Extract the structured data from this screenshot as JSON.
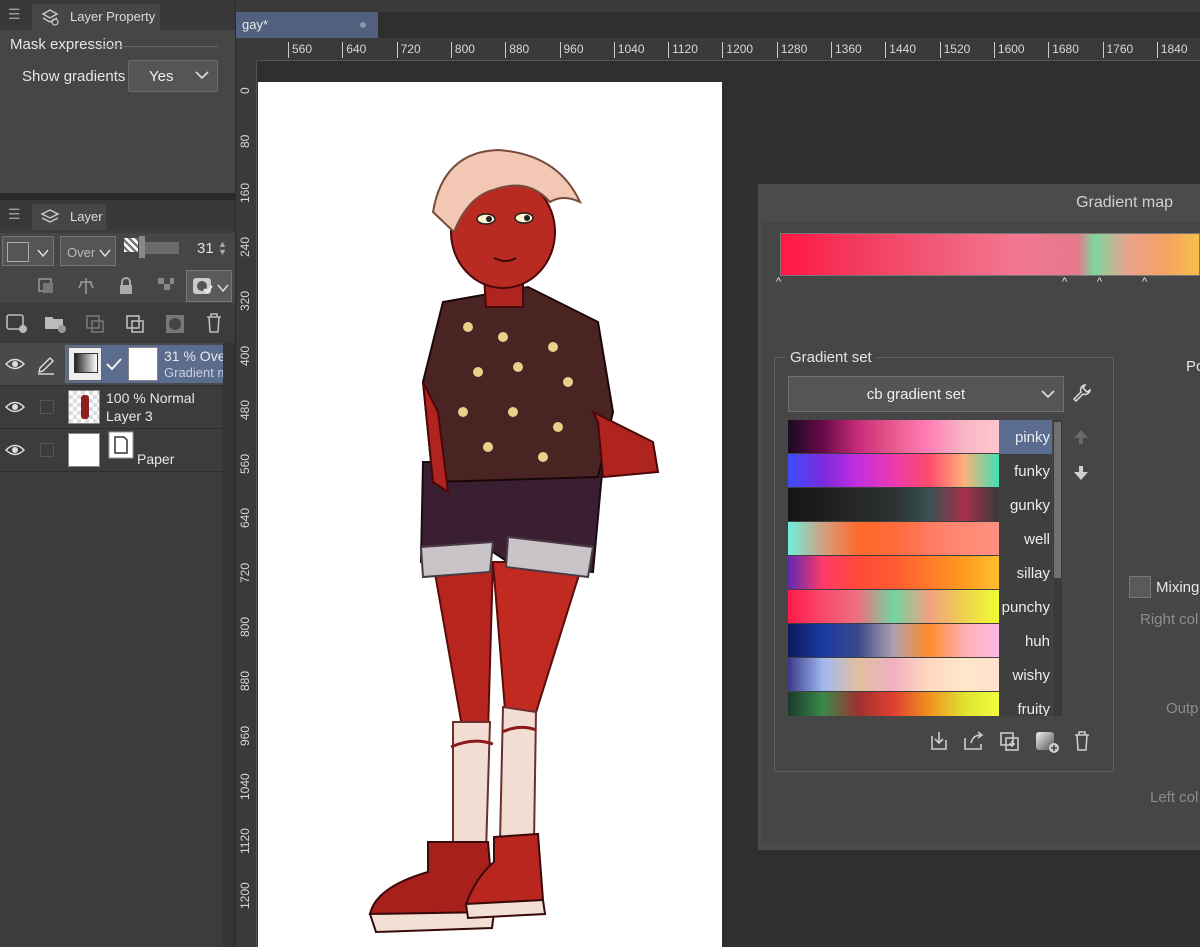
{
  "layer_property": {
    "tab_label": "Layer Property",
    "section_title": "Mask expression",
    "show_gradients_label": "Show gradients",
    "show_gradients_value": "Yes"
  },
  "layer_panel": {
    "tab_label": "Layer",
    "blend_mode": "Over",
    "opacity": "31",
    "layers": [
      {
        "line1": "31 % Ove",
        "line2": "Gradient m",
        "selected": true
      },
      {
        "line1": "100 % Normal",
        "line2": "Layer 3",
        "selected": false
      },
      {
        "line1": "Paper",
        "line2": "",
        "selected": false
      }
    ]
  },
  "document": {
    "tab_title": "gay*"
  },
  "ruler": {
    "horizontal": [
      "560",
      "640",
      "720",
      "800",
      "880",
      "960",
      "1040",
      "1120",
      "1200",
      "1280",
      "1360",
      "1440",
      "1520",
      "1600",
      "1680",
      "1760",
      "1840"
    ],
    "vertical": [
      "0",
      "80",
      "160",
      "240",
      "320",
      "400",
      "480",
      "560",
      "640",
      "720",
      "800",
      "880",
      "960",
      "1040",
      "1120",
      "1200"
    ]
  },
  "gradient_map": {
    "title": "Gradient map",
    "gradient_set_label": "Gradient set",
    "gradient_set_value": "cb gradient set",
    "sets": [
      {
        "name": "pinky",
        "selected": true,
        "colors": [
          "#1a0a1f",
          "#6a0a4a",
          "#c82c7a",
          "#e85a8e",
          "#ff7fb4",
          "#f7b6c4",
          "#ffc6d0"
        ]
      },
      {
        "name": "funky",
        "selected": false,
        "colors": [
          "#3d4cff",
          "#7a2bdc",
          "#c42ee0",
          "#ea3ab0",
          "#ff4a6b",
          "#ffb07a",
          "#40e0b0"
        ]
      },
      {
        "name": "gunky",
        "selected": false,
        "colors": [
          "#141414",
          "#1e1e1e",
          "#272727",
          "#2c3232",
          "#355252",
          "#a8304a",
          "#3a3a3a"
        ]
      },
      {
        "name": "well",
        "selected": false,
        "colors": [
          "#6cf0e0",
          "#d0a080",
          "#ff6a2a",
          "#ff6a3a",
          "#ff7a60",
          "#ff8a74",
          "#ff9080"
        ]
      },
      {
        "name": "sillay",
        "selected": false,
        "colors": [
          "#5e2ab0",
          "#ff3a6a",
          "#ff4a3a",
          "#ff5a30",
          "#ff7a2a",
          "#ff9a20",
          "#ffc030"
        ]
      },
      {
        "name": "punchy",
        "selected": false,
        "colors": [
          "#ff1a4a",
          "#f84a6c",
          "#ee7080",
          "#70d6a0",
          "#f0a080",
          "#f0d050",
          "#f0ff30"
        ]
      },
      {
        "name": "huh",
        "selected": false,
        "colors": [
          "#0a1a5a",
          "#1a3aa0",
          "#3a4a8a",
          "#b0a0b0",
          "#ff8a2a",
          "#ffb0b0",
          "#ffb8e8"
        ]
      },
      {
        "name": "wishy",
        "selected": false,
        "colors": [
          "#3a3a8a",
          "#a0b8f0",
          "#e0c0a0",
          "#f0b0c0",
          "#ffd8c0",
          "#ffe8c8",
          "#ffe0d0"
        ]
      },
      {
        "name": "fruity",
        "selected": false,
        "colors": [
          "#1a3a2a",
          "#3a8a4a",
          "#a03030",
          "#e04030",
          "#f09020",
          "#e0e030",
          "#f0ff40"
        ]
      }
    ],
    "side_labels": {
      "po": "Po",
      "mixing": "Mixing",
      "right_color": "Right col",
      "output": "Outp",
      "left_color": "Left col"
    }
  }
}
